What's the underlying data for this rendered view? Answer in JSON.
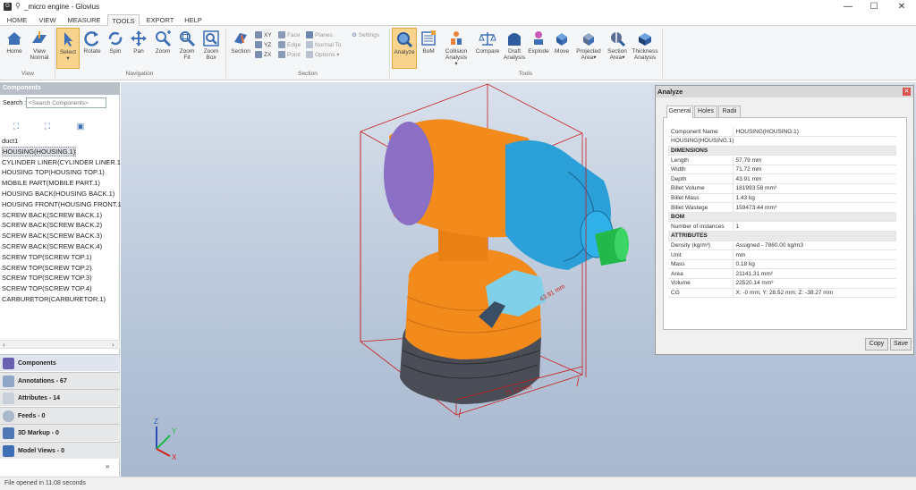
{
  "window": {
    "title": "_micro engine - Glovius",
    "app_icon": "G",
    "pin": "⚲",
    "minimize": "—",
    "maximize": "☐",
    "close": "✕"
  },
  "menu": [
    "HOME",
    "VIEW",
    "MEASURE",
    "TOOLS",
    "EXPORT",
    "HELP"
  ],
  "ribbon": {
    "view": {
      "home": "Home",
      "view": "View Normal",
      "group": "View"
    },
    "navigation": {
      "select": "Select",
      "rotate": "Rotate",
      "spin": "Spin",
      "pan": "Pan",
      "zoom": "Zoom",
      "zoom_fit": "Zoom Fit",
      "zoom_box": "Zoom Box",
      "group": "Navigation"
    },
    "section": {
      "section": "Section",
      "xy": "XY",
      "yz": "YZ",
      "zx": "ZX",
      "face": "Face",
      "edge": "Edge",
      "point": "Point",
      "planes": "Planes",
      "normal_to": "Normal To",
      "options": "Options",
      "settings": "Settings",
      "group": "Section"
    },
    "tools": {
      "analyze": "Analyze",
      "bom": "BoM",
      "collision": "Collision Analysis",
      "compare": "Compare",
      "draft": "Draft Analysis",
      "explode": "Explode",
      "move": "Move",
      "projected_area": "Projected Area",
      "section_area": "Section Area",
      "thickness": "Thickness Analysis",
      "group": "Tools"
    }
  },
  "components_panel": {
    "header": "Components",
    "search_label": "Search :",
    "search_placeholder": "<Search Components>",
    "tree": [
      "duct1",
      "HOUSING(HOUSING.1)",
      "CYLINDER LINER(CYLINDER LINER.1)",
      "HOUSING TOP(HOUSING TOP.1)",
      "MOBILE PART(MOBILE PART.1)",
      "HOUSING BACK(HOUSING BACK.1)",
      "HOUSING FRONT(HOUSING FRONT.1",
      "SCREW BACK(SCREW BACK.1)",
      "SCREW BACK(SCREW BACK.2)",
      "SCREW BACK(SCREW BACK.3)",
      "SCREW BACK(SCREW BACK.4)",
      "SCREW TOP(SCREW TOP.1)",
      "SCREW TOP(SCREW TOP.2)",
      "SCREW TOP(SCREW TOP.3)",
      "SCREW TOP(SCREW TOP.4)",
      "CARBURETOR(CARBURETOR.1)"
    ],
    "buttons": [
      "Components",
      "Annotations - 67",
      "Attributes - 14",
      "Feeds - 0",
      "3D Markup - 0",
      "Model Views - 0"
    ],
    "more": "»"
  },
  "status": "File opened in 11.08 seconds",
  "analyze": {
    "title": "Analyze",
    "tabs": [
      "General",
      "Holes",
      "Radii"
    ],
    "rows": [
      {
        "k": "Component Name",
        "v": "HOUSING(HOUSING.1)"
      },
      {
        "span": "HOUSING(HOUSING.1)"
      },
      {
        "section": "DIMENSIONS"
      },
      {
        "k": "Length",
        "v": "57.79 mm"
      },
      {
        "k": "Width",
        "v": "71.72 mm"
      },
      {
        "k": "Depth",
        "v": "43.91 mm"
      },
      {
        "k": "Billet Volume",
        "v": "181993.58 mm³"
      },
      {
        "k": "Billet Mass",
        "v": "1.43 kg"
      },
      {
        "k": "Billet Wastege",
        "v": "159473.44  mm³"
      },
      {
        "section": "BOM"
      },
      {
        "k": "Number of instances",
        "v": "1"
      },
      {
        "section": "ATTRIBUTES"
      },
      {
        "k": "Density (kg/m³)",
        "v": "Assigned - 7860.00 kg/m3"
      },
      {
        "k": "Unit",
        "v": "mm"
      },
      {
        "k": "Mass",
        "v": "0.18  kg"
      },
      {
        "k": "Area",
        "v": "21141.31  mm²"
      },
      {
        "k": "Volume",
        "v": "22520.14  mm³"
      },
      {
        "k": "CG",
        "v": "X: -0  mm; Y: 28.52  mm; Z: -38.27  mm"
      }
    ],
    "copy": "Copy",
    "save": "Save"
  },
  "triad": {
    "x": "X",
    "y": "Y",
    "z": "Z"
  },
  "dims": {
    "a": "57.79 mm",
    "b": "71.72 mm",
    "c": "43.91 mm"
  }
}
